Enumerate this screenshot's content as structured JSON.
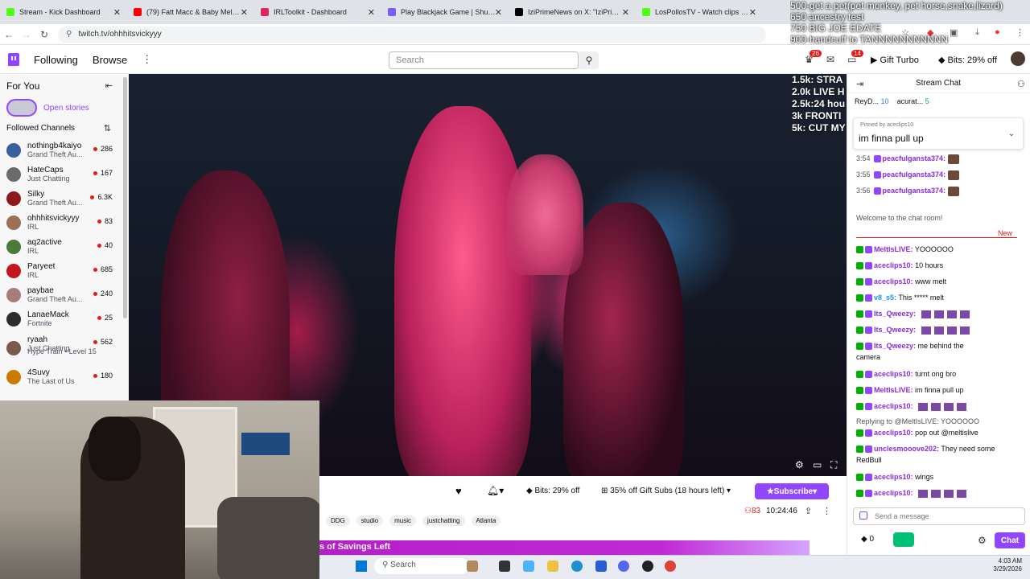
{
  "browser": {
    "tabs": [
      {
        "label": "Stream - Kick Dashboard",
        "color": "#53fc18"
      },
      {
        "label": "(79) Fatt Macc & Baby Mel - \"C",
        "color": "#ff0000"
      },
      {
        "label": "IRLToolkit - Dashboard",
        "color": "#e0245e"
      },
      {
        "label": "Play Blackjack Game | Shuffle.u",
        "color": "#7b5cff"
      },
      {
        "label": "IziPrimeNews on X: \"IziPrime re",
        "color": "#000000"
      },
      {
        "label": "LosPollosTV - Watch clips on K",
        "color": "#53fc18"
      }
    ],
    "url": "twitch.tv/ohhhitsvickyyy"
  },
  "overlay_topright": [
    "500-get a pet(pet monkey, pet horse,snake,lizard)",
    "650 ancestry test",
    "750 BIG JOE EDATE",
    "900-handcuff to TANNNNNNNNNNN"
  ],
  "overlay_left_list": [
    "1.5k: STRA",
    "2.0k LIVE H",
    "2.5k:24 hou",
    "3k FRONTI",
    "5k: CUT MY"
  ],
  "twitch_nav": {
    "following": "Following",
    "browse": "Browse",
    "search_placeholder": "Search",
    "notif_count_1": "26",
    "notif_count_2": "14",
    "gift_turbo": "Gift Turbo",
    "bits": "Bits: 29% off"
  },
  "sidebar": {
    "for_you": "For You",
    "open_stories": "Open stories",
    "followed_channels": "Followed Channels",
    "channels": [
      {
        "name": "nothingb4kaiyo",
        "game": "Grand Theft Au...",
        "viewers": "286",
        "color": "#3a5f9e"
      },
      {
        "name": "HateCaps",
        "game": "Just Chatting",
        "viewers": "167",
        "color": "#6b6b6b"
      },
      {
        "name": "Silky",
        "game": "Grand Theft Au...",
        "viewers": "6.3K",
        "color": "#8b1a1a"
      },
      {
        "name": "ohhhitsvickyyy",
        "game": "IRL",
        "viewers": "83",
        "color": "#9c6f58"
      },
      {
        "name": "aq2active",
        "game": "IRL",
        "viewers": "40",
        "color": "#4d7a3a"
      },
      {
        "name": "Paryeet",
        "game": "IRL",
        "viewers": "685",
        "color": "#c4161c"
      },
      {
        "name": "paybae",
        "game": "Grand Theft Au...",
        "viewers": "240",
        "color": "#a67c7c"
      },
      {
        "name": "LanaeMack",
        "game": "Fortnite",
        "viewers": "25",
        "color": "#2d2d2d"
      },
      {
        "name": "ryaah",
        "game": "Just Chatting",
        "viewers": "562",
        "color": "#7a5a4a"
      },
      {
        "name": "4Suvy",
        "game": "The Last of Us",
        "viewers": "180",
        "color": "#cc7a00"
      }
    ],
    "hype_train": "Hype Train • Level 15"
  },
  "below_video": {
    "bits": "Bits: 29% off",
    "gift_subs": "35% off Gift Subs (18 hours left)",
    "subscribe": "Subscribe",
    "viewers": "83",
    "uptime": "10:24:46",
    "tags": [
      "DDG",
      "studio",
      "music",
      "justchatting",
      "Atlanta"
    ],
    "banner": "s of Savings Left"
  },
  "taskbar": {
    "search": "Search",
    "time": "4:03 AM",
    "date": "3/29/2026"
  },
  "chat": {
    "title": "Stream Chat",
    "leaderboard": [
      {
        "name": "ReyD...",
        "count": "10"
      },
      {
        "name": "acurat...",
        "count": "5"
      }
    ],
    "pinned_by": "Pinned by aceclips10",
    "pinned_message": "im finna pull up",
    "messages": [
      {
        "ts": "3:54",
        "user": "peacfulgansta374:",
        "text": "",
        "color": "#8a2be2"
      },
      {
        "ts": "3:55",
        "user": "peacfulgansta374:",
        "text": "",
        "color": "#8a2be2"
      },
      {
        "ts": "3:56",
        "user": "peacfulgansta374:",
        "text": "",
        "color": "#8a2be2"
      }
    ],
    "welcome": "Welcome to the chat room!",
    "new_label": "New",
    "live_messages": [
      {
        "user": "MeltIsLIVE:",
        "text": "YOOOOOO",
        "color": "#8a2be2"
      },
      {
        "user": "aceclips10:",
        "text": "10 hours",
        "color": "#8a2be2"
      },
      {
        "user": "aceclips10:",
        "text": "www melt",
        "color": "#8a2be2"
      },
      {
        "user": "v8_s5:",
        "text": "This ***** melt",
        "color": "#1e90ff"
      },
      {
        "user": "Its_Qweezy:",
        "text": "",
        "color": "#8a2be2"
      },
      {
        "user": "Its_Qweezy:",
        "text": "",
        "color": "#8a2be2"
      },
      {
        "user": "Its_Qweezy:",
        "text": "me behind the",
        "color": "#8a2be2"
      },
      {
        "user": "",
        "text": "camera",
        "color": "#0e0e10"
      },
      {
        "user": "aceclips10:",
        "text": "turnt ong bro",
        "color": "#8a2be2"
      },
      {
        "user": "MeltIsLIVE:",
        "text": "im finna pull up",
        "color": "#8a2be2"
      },
      {
        "user": "aceclips10:",
        "text": "",
        "color": "#8a2be2"
      },
      {
        "user": "",
        "text": "Replying to @MeltIsLIVE: YOOOOOO",
        "color": "#53535f"
      },
      {
        "user": "aceclips10:",
        "text": "pop out @meltislive",
        "color": "#8a2be2"
      },
      {
        "user": "unclesmooove202:",
        "text": "They need some",
        "color": "#8a2be2"
      },
      {
        "user": "",
        "text": "RedBull",
        "color": "#0e0e10"
      },
      {
        "user": "aceclips10:",
        "text": "wings",
        "color": "#8a2be2"
      },
      {
        "user": "aceclips10:",
        "text": "",
        "color": "#8a2be2"
      }
    ],
    "input_placeholder": "Send a message",
    "bits_count": "0",
    "chat_button": "Chat"
  }
}
